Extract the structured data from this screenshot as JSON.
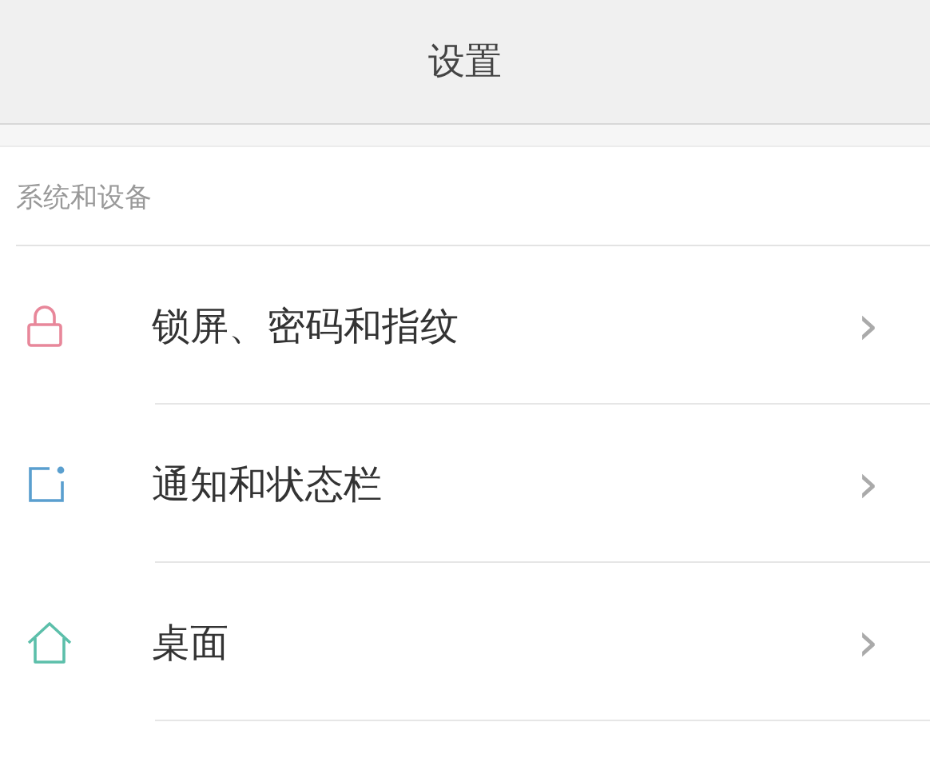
{
  "header": {
    "title": "设置"
  },
  "section": {
    "title": "系统和设备",
    "items": [
      {
        "label": "锁屏、密码和指纹",
        "kind": "lock",
        "color": "#e8879a",
        "chevron": "›"
      },
      {
        "label": "通知和状态栏",
        "kind": "notification",
        "color": "#5a9fcf",
        "chevron": "›"
      },
      {
        "label": "桌面",
        "kind": "home",
        "color": "#5cbfaa",
        "chevron": "›"
      }
    ]
  }
}
